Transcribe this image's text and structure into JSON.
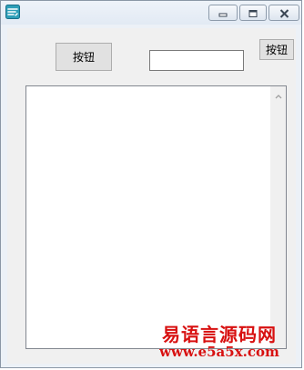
{
  "window": {
    "title": "",
    "icon": "app-icon"
  },
  "controls": {
    "button1_label": "按钮",
    "button2_label": "按钮",
    "text_input_value": "",
    "text_input_placeholder": "",
    "editbox_content": ""
  },
  "watermark": {
    "line1": "易语言源码网",
    "line2": "www.e5a5x.com"
  },
  "colors": {
    "watermark": "#d81010",
    "window_frame": "#ecf1f7",
    "client_bg": "#f0f0f0"
  }
}
